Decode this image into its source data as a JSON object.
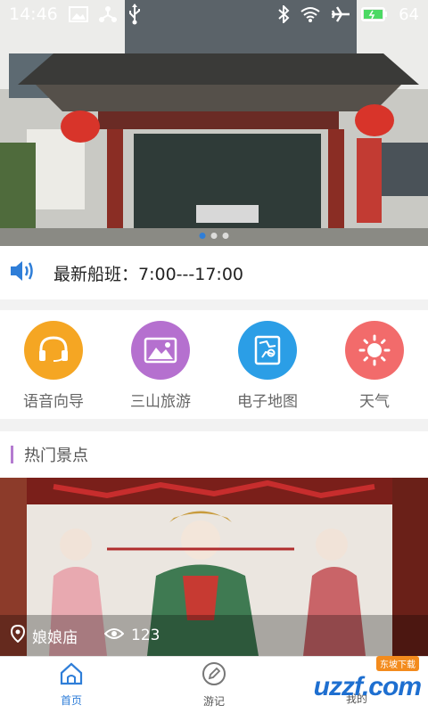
{
  "status_bar": {
    "time": "14:46",
    "battery": "64",
    "icons": [
      "image-icon",
      "usb-share-icon",
      "usb-icon",
      "bluetooth-icon",
      "wifi-icon",
      "airplane-icon",
      "battery-icon"
    ]
  },
  "banner": {
    "image": "temple-gate-photo",
    "dots": 3,
    "active_dot": 0
  },
  "notice": {
    "icon": "speaker-icon",
    "text": "最新船班：7:00---17:00"
  },
  "quick_menu": [
    {
      "label": "语音向导",
      "icon": "headset-icon",
      "color": "#f5a623"
    },
    {
      "label": "三山旅游",
      "icon": "landscape-icon",
      "color": "#b570cf"
    },
    {
      "label": "电子地图",
      "icon": "map-icon",
      "color": "#2b9ee6"
    },
    {
      "label": "天气",
      "icon": "sun-icon",
      "color": "#f26b6b"
    }
  ],
  "section": {
    "title": "热门景点"
  },
  "attraction": {
    "name": "娘娘庙",
    "views": "123",
    "image": "goddess-statues-photo"
  },
  "tabs": [
    {
      "label": "首页",
      "icon": "home-icon",
      "active": true
    },
    {
      "label": "游记",
      "icon": "pen-icon",
      "active": false
    },
    {
      "label": "我的",
      "icon": "user-icon",
      "active": false
    }
  ],
  "watermark": {
    "text": "uzzf.com",
    "badge": "东坡下载"
  },
  "colors": {
    "accent": "#2f7ed8",
    "section_bar": "#b47bd0"
  }
}
